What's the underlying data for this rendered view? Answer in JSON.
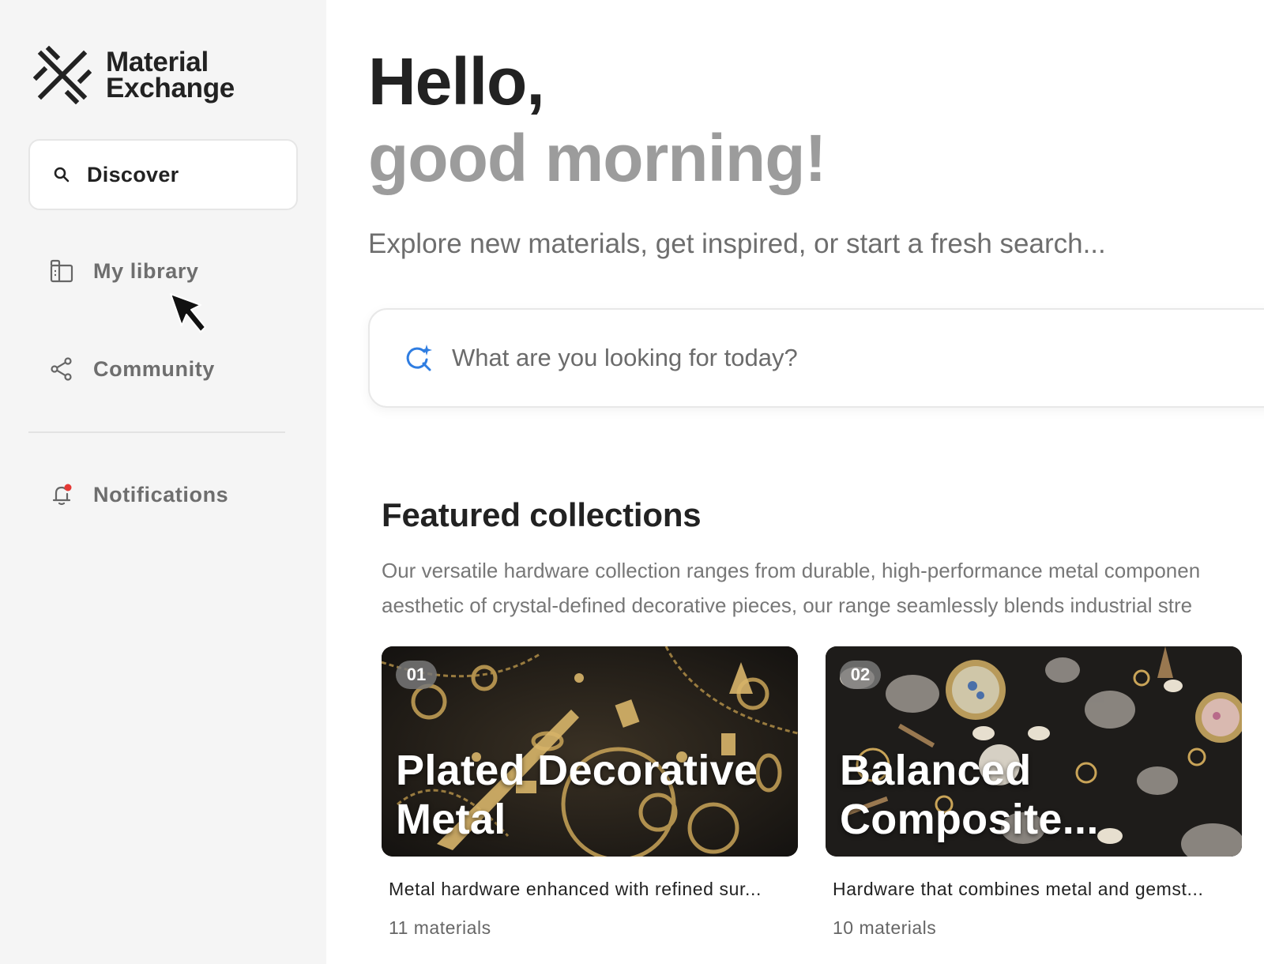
{
  "brand": {
    "line1": "Material",
    "line2": "Exchange"
  },
  "sidebar": {
    "discover_label": "Discover",
    "items": [
      {
        "label": "My library",
        "icon": "library-icon"
      },
      {
        "label": "Community",
        "icon": "share-icon"
      },
      {
        "label": "Notifications",
        "icon": "bell-icon"
      }
    ]
  },
  "greeting": {
    "line1": "Hello,",
    "line2": "good morning!"
  },
  "subtitle": "Explore new materials, get inspired, or start a fresh search...",
  "search": {
    "placeholder": "What are you looking for today?",
    "icon": "ai-search-icon"
  },
  "featured": {
    "title": "Featured collections",
    "description_line1": "Our versatile hardware collection ranges from durable, high-performance metal componen",
    "description_line2": "aesthetic of crystal-defined decorative pieces, our range seamlessly blends industrial stre",
    "cards": [
      {
        "number": "01",
        "title_line1": "Plated Decorative",
        "title_line2": "Metal",
        "description": "Metal hardware enhanced with refined sur...",
        "count": "11 materials"
      },
      {
        "number": "02",
        "title_line1": "Balanced",
        "title_line2": "Composite...",
        "description": "Hardware that combines metal and gemst...",
        "count": "10 materials"
      }
    ]
  },
  "colors": {
    "sidebar_bg": "#f5f5f5",
    "accent_blue": "#2f7de1",
    "notification_dot": "#e53935",
    "muted_text": "#6e6e6e"
  }
}
